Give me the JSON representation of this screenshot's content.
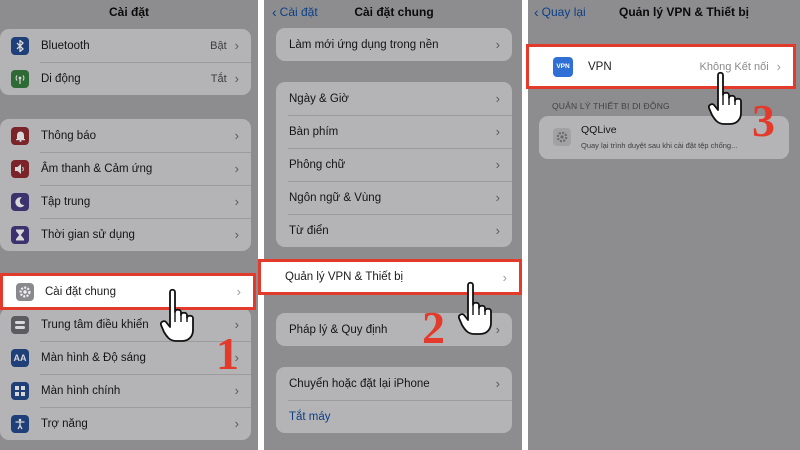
{
  "panel1": {
    "title": "Cài đặt",
    "group_top": [
      {
        "label": "Bluetooth",
        "value": "Bật",
        "icon": "bluetooth-icon",
        "color": "#1f3f78"
      },
      {
        "label": "Di động",
        "value": "Tắt",
        "icon": "cellular-icon",
        "color": "#2e6a35"
      }
    ],
    "group_mid": [
      {
        "label": "Thông báo",
        "icon": "notification-icon",
        "color": "#7a2328"
      },
      {
        "label": "Âm thanh & Cảm ứng",
        "icon": "sound-icon",
        "color": "#7a2328"
      },
      {
        "label": "Tập trung",
        "icon": "moon-icon",
        "color": "#3b326e"
      },
      {
        "label": "Thời gian sử dụng",
        "icon": "hourglass-icon",
        "color": "#3b326e"
      }
    ],
    "highlighted_item": {
      "label": "Cài đặt chung",
      "icon": "gear-icon",
      "color": "#8a8a8e"
    },
    "group_bottom": [
      {
        "label": "Trung tâm điều khiển",
        "icon": "control-center-icon",
        "color": "#5c5c60"
      },
      {
        "label": "Màn hình & Độ sáng",
        "icon": "display-icon",
        "color": "#1f3f78"
      },
      {
        "label": "Màn hình chính",
        "icon": "home-screen-icon",
        "color": "#1f3f78"
      },
      {
        "label": "Trợ năng",
        "icon": "accessibility-icon",
        "color": "#1f3f78"
      }
    ],
    "step_number": "1"
  },
  "panel2": {
    "back_label": "Cài đặt",
    "title": "Cài đặt chung",
    "group_top": [
      {
        "label": "Làm mới ứng dụng trong nền"
      }
    ],
    "group_mid": [
      {
        "label": "Ngày & Giờ"
      },
      {
        "label": "Bàn phím"
      },
      {
        "label": "Phông chữ"
      },
      {
        "label": "Ngôn ngữ & Vùng"
      },
      {
        "label": "Từ điển"
      }
    ],
    "highlighted_item": {
      "label": "Quản lý VPN & Thiết bị"
    },
    "group_legal": [
      {
        "label": "Pháp lý & Quy định"
      }
    ],
    "group_bottom": [
      {
        "label": "Chuyển hoặc đặt lại iPhone"
      },
      {
        "label": "Tắt máy"
      }
    ],
    "step_number": "2"
  },
  "panel3": {
    "back_label": "Quay lại",
    "title": "Quản lý VPN & Thiết bị",
    "vpn": {
      "label": "VPN",
      "value": "Không Kết nối",
      "icon_text": "VPN",
      "color": "#2f6fd6"
    },
    "section_header": "QUẢN LÝ THIẾT BỊ DI ĐỘNG",
    "profile": {
      "name": "QQLive",
      "subtitle": "Quay lại trình duyệt sau khi cài đặt tệp chống..."
    },
    "step_number": "3"
  },
  "colors": {
    "highlight": "#e23a2b",
    "dim_background": "#8d8d8f",
    "group_background": "#b4b4b6"
  }
}
